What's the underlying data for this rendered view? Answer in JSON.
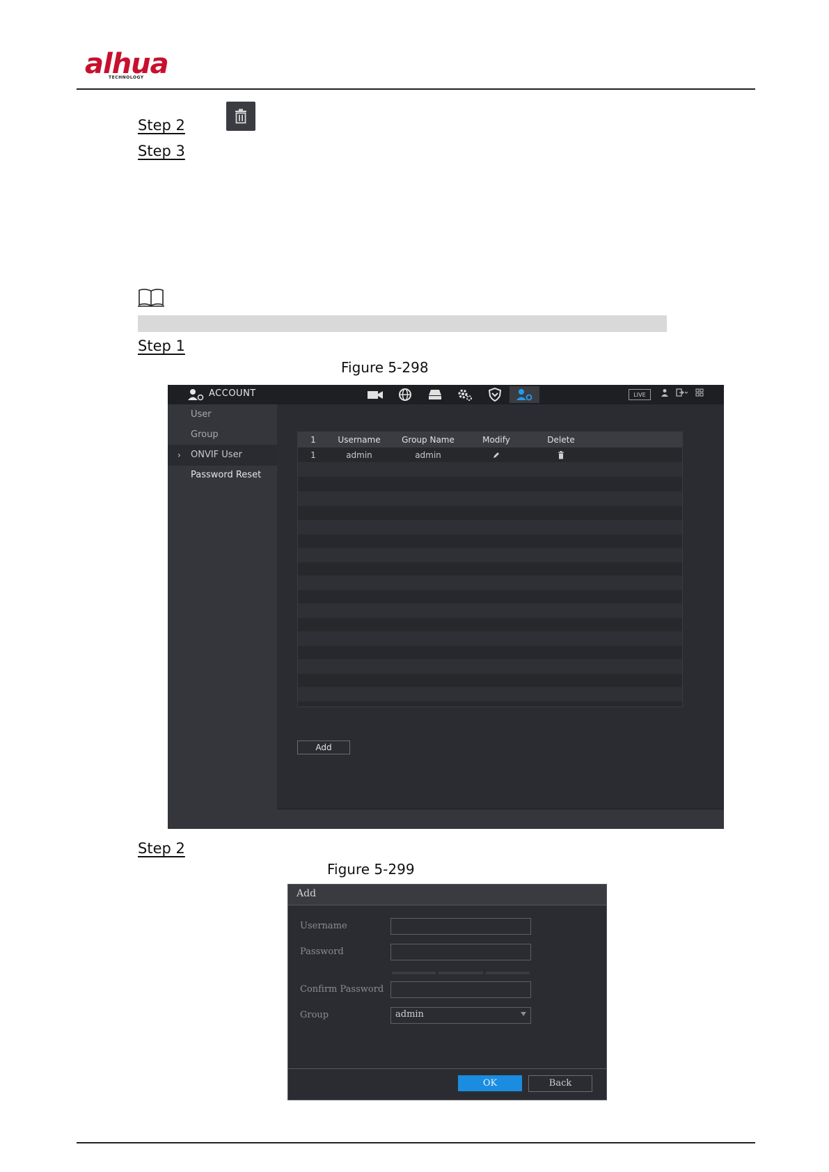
{
  "header": {
    "logo_text": "alhua",
    "logo_sub": "TECHNOLOGY"
  },
  "steps": {
    "step2_top": "Step 2",
    "step3": "Step 3",
    "step1": "Step 1",
    "step2_bottom": "Step 2"
  },
  "figures": {
    "fig1_caption": "Figure 5-298",
    "fig2_caption": "Figure 5-299"
  },
  "account_ui": {
    "title": "ACCOUNT",
    "live_badge": "LIVE",
    "sidebar": [
      {
        "label": "User"
      },
      {
        "label": "Group"
      },
      {
        "label": "ONVIF User",
        "active": true
      },
      {
        "label": "Password Reset"
      }
    ],
    "table": {
      "headers": [
        "1",
        "Username",
        "Group Name",
        "Modify",
        "Delete"
      ],
      "rows": [
        {
          "index": "1",
          "username": "admin",
          "group": "admin"
        }
      ]
    },
    "add_label": "Add"
  },
  "add_dialog": {
    "title": "Add",
    "username_label": "Username",
    "password_label": "Password",
    "confirm_label": "Confirm Password",
    "group_label": "Group",
    "group_value": "admin",
    "ok_label": "OK",
    "back_label": "Back"
  },
  "colors": {
    "accent": "#1a8de0",
    "logo_red": "#c8102e",
    "ui_background": "#2b2c31"
  }
}
